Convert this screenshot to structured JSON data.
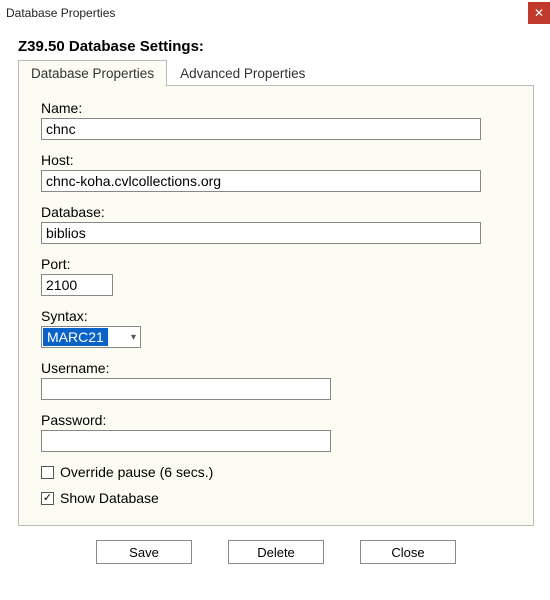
{
  "window": {
    "title": "Database Properties"
  },
  "heading": "Z39.50 Database Settings:",
  "tabs": [
    {
      "label": "Database Properties",
      "active": true
    },
    {
      "label": "Advanced Properties",
      "active": false
    }
  ],
  "fields": {
    "name": {
      "label": "Name:",
      "value": "chnc"
    },
    "host": {
      "label": "Host:",
      "value": "chnc-koha.cvlcollections.org"
    },
    "database": {
      "label": "Database:",
      "value": "biblios"
    },
    "port": {
      "label": "Port:",
      "value": "2100"
    },
    "syntax": {
      "label": "Syntax:",
      "value": "MARC21"
    },
    "username": {
      "label": "Username:",
      "value": ""
    },
    "password": {
      "label": "Password:",
      "value": ""
    }
  },
  "checkboxes": {
    "override_pause": {
      "label": "Override pause (6 secs.)",
      "checked": false
    },
    "show_database": {
      "label": "Show Database",
      "checked": true
    }
  },
  "buttons": {
    "save": "Save",
    "delete": "Delete",
    "close": "Close"
  }
}
